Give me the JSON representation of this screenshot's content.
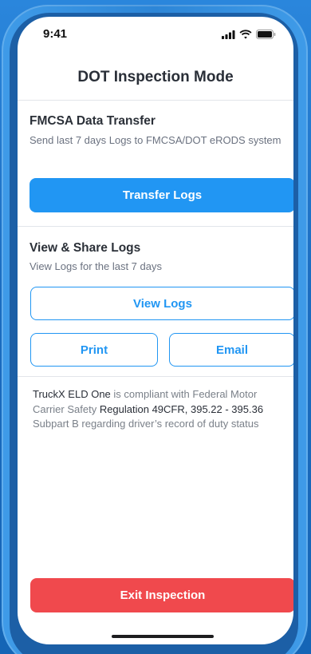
{
  "status_bar": {
    "time": "9:41"
  },
  "header": {
    "title": "DOT Inspection Mode"
  },
  "fmcsa": {
    "title": "FMCSA Data Transfer",
    "description": "Send last 7 days Logs to FMCSA/DOT eRODS system",
    "transfer_button": "Transfer Logs"
  },
  "view_share": {
    "title": "View & Share Logs",
    "description": "View Logs for the last 7 days",
    "view_button": "View Logs",
    "print_button": "Print",
    "email_button": "Email"
  },
  "compliance": {
    "part1": "TruckX ELD One",
    "part2": " is compliant with Federal Motor Carrier Safety ",
    "part3": "Regulation 49CFR, 395.22 - 395.36",
    "part4": " Subpart B regarding driver’s record of duty status"
  },
  "footer": {
    "exit_button": "Exit Inspection"
  },
  "colors": {
    "primary": "#2196f3",
    "danger": "#f0494d",
    "background": "#1b6cc0"
  }
}
